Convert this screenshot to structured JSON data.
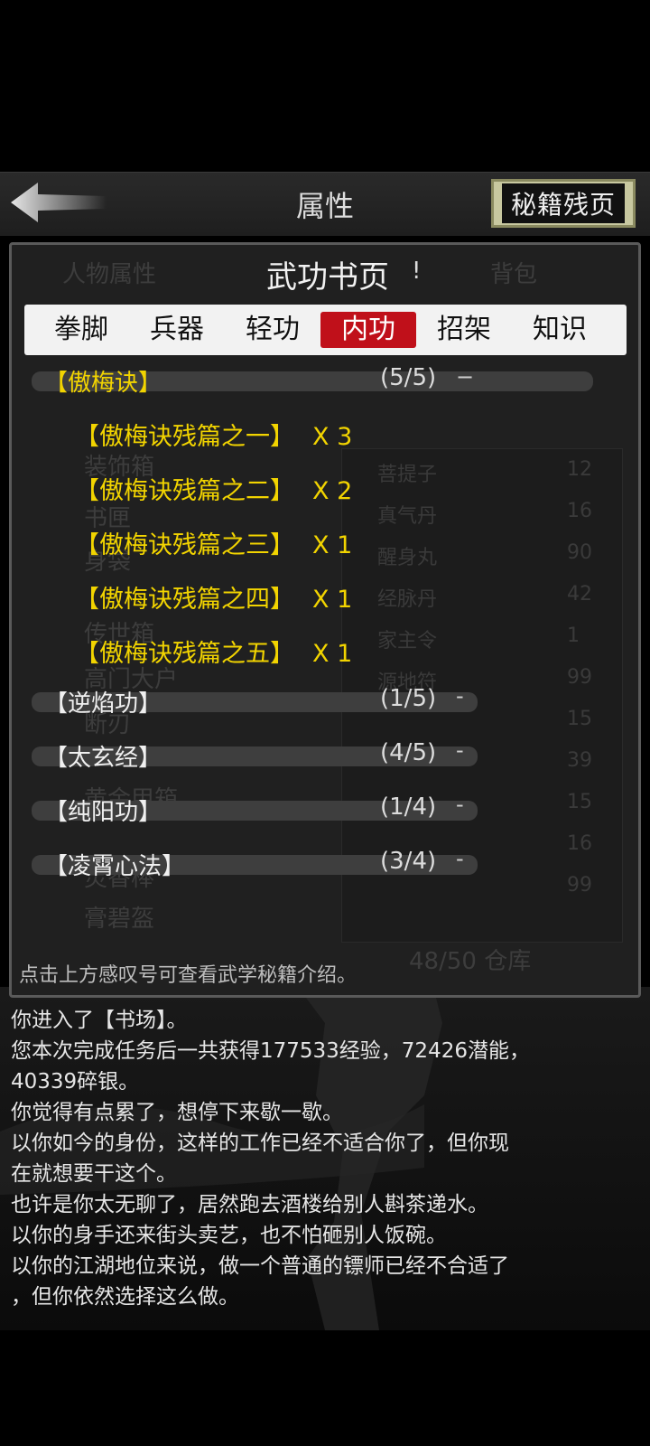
{
  "header": {
    "title": "属性",
    "pages_button": "秘籍残页"
  },
  "background": {
    "tab_left": "人物属性",
    "tab_right": "背包",
    "categories": [
      "装饰箱",
      "书匣",
      "身袋",
      "传世箱",
      "高门大户",
      "断刃",
      "黄金甲箱",
      "灵香棒",
      "膏碧盔"
    ],
    "items": [
      {
        "name": "菩提子",
        "num": "12"
      },
      {
        "name": "真气丹",
        "num": "16"
      },
      {
        "name": "醒身丸",
        "num": "90"
      },
      {
        "name": "经脉丹",
        "num": "42"
      },
      {
        "name": "家主令",
        "num": "1"
      },
      {
        "name": "源地符",
        "num": "99"
      },
      {
        "name": "",
        "num": "15"
      },
      {
        "name": "",
        "num": "39"
      },
      {
        "name": "",
        "num": "15"
      },
      {
        "name": "",
        "num": "16"
      },
      {
        "name": "",
        "num": "99"
      }
    ],
    "storage": "48/50 仓库"
  },
  "dialog": {
    "title": "武功书页",
    "info_mark": "!",
    "tabs": [
      "拳脚",
      "兵器",
      "轻功",
      "内功",
      "招架",
      "知识"
    ],
    "active_tab": "内功",
    "expanded": {
      "name": "【傲梅诀】",
      "count": "(5/5)",
      "toggle": "−",
      "books": [
        {
          "name": "【傲梅诀残篇之一】",
          "qty": "X 3"
        },
        {
          "name": "【傲梅诀残篇之二】",
          "qty": "X 2"
        },
        {
          "name": "【傲梅诀残篇之三】",
          "qty": "X 1"
        },
        {
          "name": "【傲梅诀残篇之四】",
          "qty": "X 1"
        },
        {
          "name": "【傲梅诀残篇之五】",
          "qty": "X 1"
        }
      ]
    },
    "collapsed": [
      {
        "name": "【逆焰功】",
        "count": "(1/5)",
        "toggle": "-"
      },
      {
        "name": "【太玄经】",
        "count": "(4/5)",
        "toggle": "-"
      },
      {
        "name": "【纯阳功】",
        "count": "(1/4)",
        "toggle": "-"
      },
      {
        "name": "【凌霄心法】",
        "count": "(3/4)",
        "toggle": "-"
      }
    ],
    "hint": "点击上方感叹号可查看武学秘籍介绍。"
  },
  "log": [
    "你进入了【书场】。",
    "您本次完成任务后一共获得177533经验，72426潜能，",
    "40339碎银。",
    "你觉得有点累了，想停下来歇一歇。",
    "以你如今的身份，这样的工作已经不适合你了，但你现",
    "在就想要干这个。",
    "也许是你太无聊了，居然跑去酒楼给别人斟茶递水。",
    "以你的身手还来街头卖艺，也不怕砸别人饭碗。",
    "以你的江湖地位来说，做一个普通的镖师已经不合适了",
    "，但你依然选择这么做。"
  ],
  "colors": {
    "gold": "#f2d400",
    "active_tab": "#c0101a",
    "panel_bg": "#202020"
  }
}
